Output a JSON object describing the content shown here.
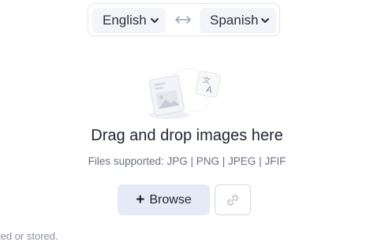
{
  "language_bar": {
    "source_language": "English",
    "target_language": "Spanish",
    "swap_icon": "double-arrow-icon"
  },
  "upload": {
    "illustration_icons": [
      "image-document-icon",
      "translate-icon"
    ],
    "title": "Drag and drop images here",
    "formats_label": "Files supported:",
    "formats": [
      "JPG",
      "PNG",
      "JPEG",
      "JFIF"
    ],
    "browse_label": "Browse",
    "browse_icon": "plus-icon",
    "url_icon": "link-icon"
  },
  "footnote": "ted or stored.",
  "colors": {
    "browse_background": "#e6eaf7",
    "select_background": "#f4f5f8",
    "muted_text": "#6b7080"
  }
}
